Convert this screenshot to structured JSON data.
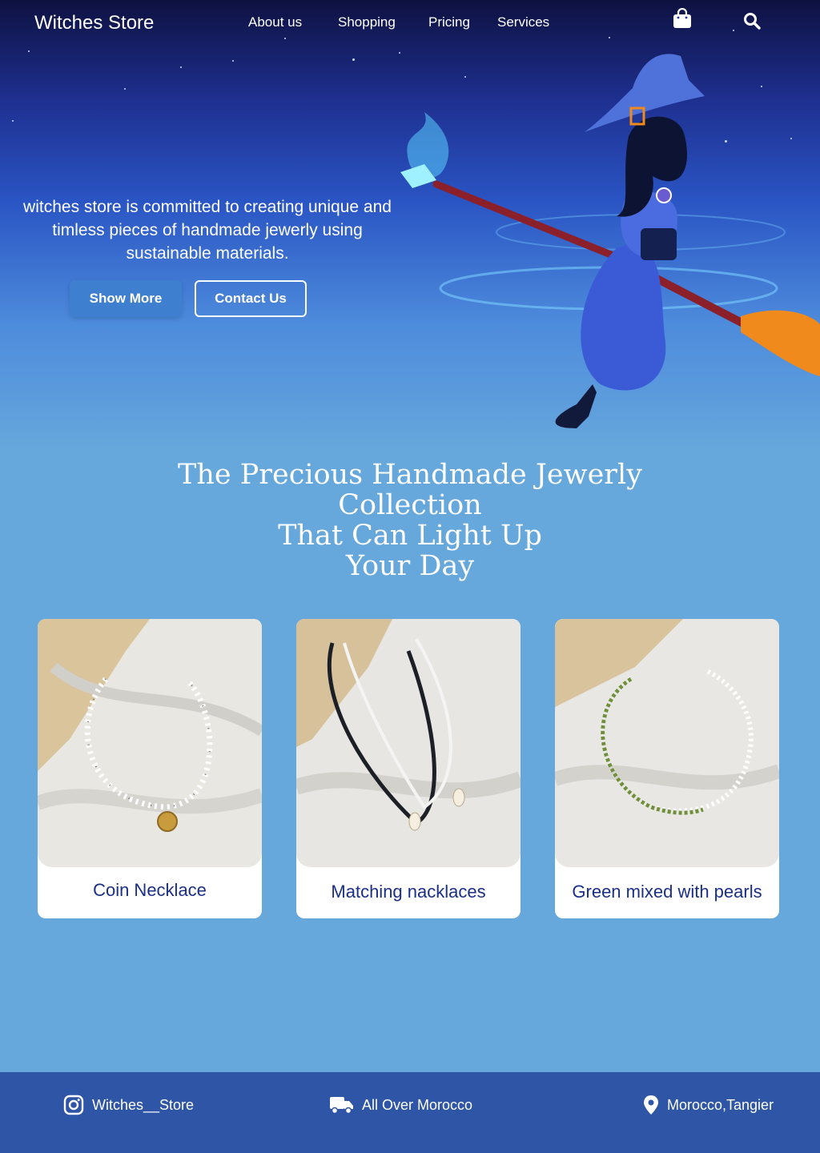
{
  "header": {
    "brand": "Witches Store",
    "nav": [
      "About us",
      "Shopping",
      "Pricing",
      "Services"
    ],
    "icons": [
      "shopping-bag-icon",
      "search-icon"
    ]
  },
  "hero": {
    "tagline": "witches store is committed to creating unique and timless pieces of handmade jewerly using sustainable materials.",
    "show_more": "Show More",
    "contact_us": "Contact Us"
  },
  "collection": {
    "headline_lines": [
      "The Precious Handmade Jewerly",
      "Collection",
      "That Can Light Up",
      "Your Day"
    ],
    "products": [
      {
        "name": "Coin Necklace"
      },
      {
        "name": "Matching nacklaces"
      },
      {
        "name": "Green mixed with pearls"
      }
    ]
  },
  "footer": {
    "instagram": "Witches__Store",
    "delivery": "All Over Morocco",
    "location": "Morocco,Tangier"
  },
  "colors": {
    "hero_top": "#0e1140",
    "background": "#66a7dc",
    "footer": "#2e55a6",
    "caption": "#1a2f86"
  }
}
